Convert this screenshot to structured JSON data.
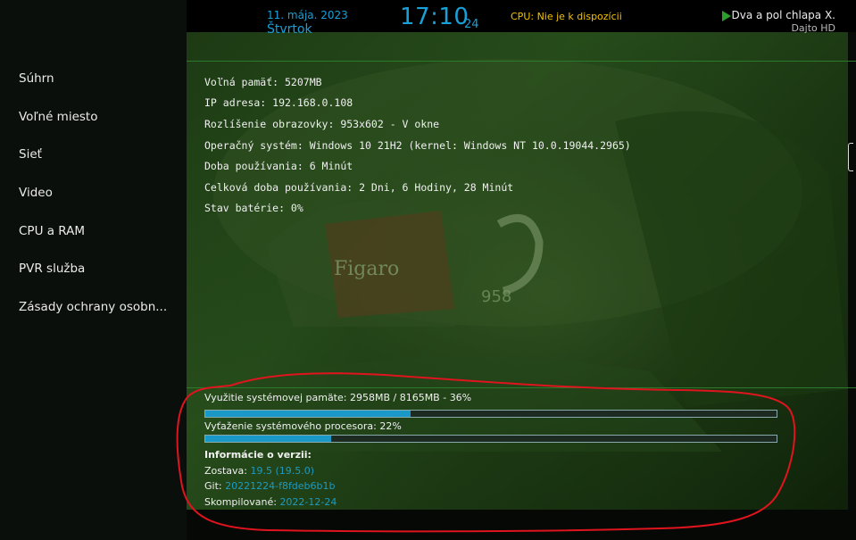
{
  "sidebar": {
    "items": [
      {
        "label": "Súhrn"
      },
      {
        "label": "Voľné miesto"
      },
      {
        "label": "Sieť"
      },
      {
        "label": "Video"
      },
      {
        "label": "CPU a RAM"
      },
      {
        "label": "PVR služba"
      },
      {
        "label": "Zásady ochrany osobn..."
      }
    ]
  },
  "header": {
    "date": "11. mája. 2023",
    "day": "Štvrtok",
    "time": "17:10",
    "seconds": "24",
    "cpu_status": "CPU: Nie je k dispozícii",
    "now_playing_title": "Dva a pol chlapa X.",
    "now_playing_channel": "Dajto HD",
    "play_icon": "play-icon"
  },
  "info_lines": [
    "Voľná pamäť: 5207MB",
    "IP adresa: 192.168.0.108",
    "Rozlíšenie obrazovky: 953x602 - V okne",
    "Operačný systém: Windows 10 21H2 (kernel: Windows NT 10.0.19044.2965)",
    "Doba používania: 6 Minút",
    "Celková doba používania: 2 Dni, 6 Hodiny, 28 Minút",
    "Stav batérie: 0%"
  ],
  "memory": {
    "label": "Využitie systémovej pamäte: 2958MB / 8165MB - 36%",
    "fraction": 0.36
  },
  "cpu_load": {
    "label": "Vyťaženie systémového procesora: 22%",
    "fraction": 0.22
  },
  "version": {
    "heading": "Informácie o verzii:",
    "build_label": "Zostava:",
    "build_value": "19.5 (19.5.0)",
    "git_label": "Git:",
    "git_value": "20221224-f8fdeb6b1b",
    "compiled_label": "Skompilované:",
    "compiled_value": "2022-12-24"
  },
  "background_art": {
    "brand_text": "Figaro",
    "number_text": "958"
  },
  "colors": {
    "accent": "#18a0d8",
    "cpu_warning": "#f2c200",
    "annotation": "#e0141e"
  }
}
